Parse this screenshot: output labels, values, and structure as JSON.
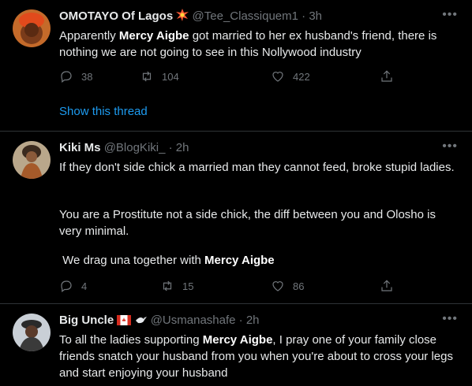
{
  "tweets": [
    {
      "name": "OMOTAYO Of Lagos",
      "handle": "@Tee_Classiquem1",
      "time": "· 3h",
      "text_pre": "Apparently ",
      "text_bold": "Mercy Aigbe",
      "text_post": " got married to her ex husband's friend, there is nothing we are not going to see in this Nollywood industry",
      "replies": "38",
      "retweets": "104",
      "likes": "422",
      "show_thread": "Show this thread"
    },
    {
      "name": "Kiki Ms",
      "handle": "@BlogKiki_",
      "time": "· 2h",
      "p1": "If they don't side chick a married man they cannot feed, broke stupid ladies.",
      "p2": "You are a Prostitute not a side chick, the diff between you and Olosho is very minimal.",
      "p3_pre": " We drag una together with ",
      "p3_bold": "Mercy Aigbe",
      "replies": "4",
      "retweets": "15",
      "likes": "86"
    },
    {
      "name": "Big Uncle",
      "handle": "@Usmanashafe",
      "time": "· 2h",
      "text_pre": "To all the ladies supporting ",
      "text_bold": "Mercy Aigbe",
      "text_post": ", I pray one of your family close friends snatch your husband from you when you're about to cross your legs and start enjoying your husband"
    }
  ],
  "icons": {
    "more": "more-icon",
    "reply": "reply-icon",
    "retweet": "retweet-icon",
    "like": "like-icon",
    "share": "share-icon",
    "collision": "collision-emoji-icon",
    "canada_flag": "canada-flag-icon",
    "dove": "dove-emoji-icon"
  },
  "colors": {
    "background": "#000000",
    "link": "#1d9bf0",
    "muted": "#71767b",
    "divider": "#2f3336"
  }
}
